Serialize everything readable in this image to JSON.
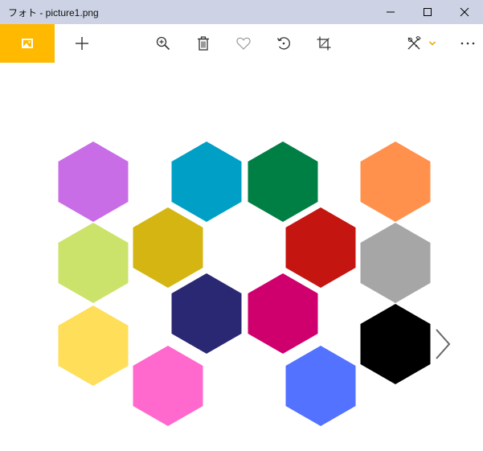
{
  "window": {
    "title": "フォト - picture1.png",
    "controls": [
      "minimize-icon",
      "maximize-icon",
      "close-icon"
    ]
  },
  "toolbar": {
    "accent_color": "#ffb900",
    "left": [
      "image-viewer-icon",
      "add-icon"
    ],
    "center": [
      "zoom-in-icon",
      "delete-icon",
      "favorite-icon",
      "rotate-icon",
      "crop-icon"
    ],
    "right": [
      "edit-create-icon",
      "chevron-down-icon",
      "more-icon"
    ]
  },
  "image": {
    "hexagon_colors": [
      "#c86de6",
      "#cbe36a",
      "#ffde5a",
      "#d4b511",
      "#ff68cd",
      "#00a0c6",
      "#2a2873",
      "#007f45",
      "#cf006d",
      "#c41510",
      "#5272ff",
      "#ff914d",
      "#a6a6a6",
      "#000000"
    ]
  },
  "navigation": {
    "next": "chevron-right-icon"
  }
}
